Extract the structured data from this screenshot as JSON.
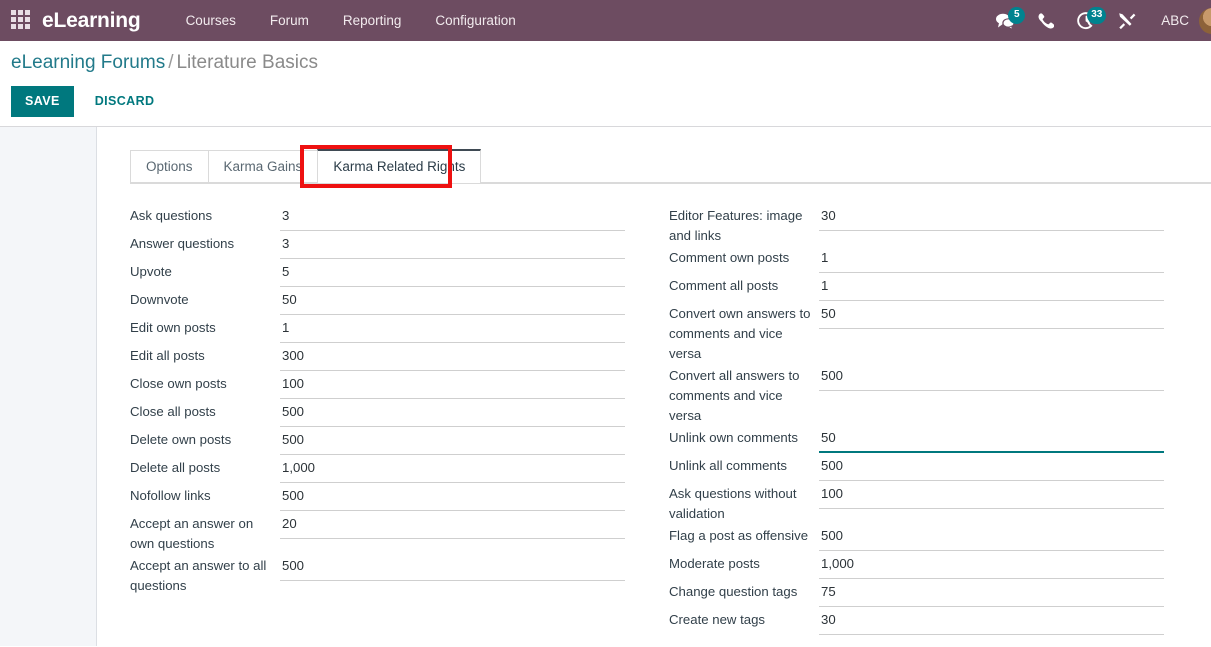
{
  "navbar": {
    "apps_icon": "apps-grid-icon",
    "brand": "eLearning",
    "menu": [
      {
        "label": "Courses"
      },
      {
        "label": "Forum"
      },
      {
        "label": "Reporting"
      },
      {
        "label": "Configuration"
      }
    ],
    "right": {
      "messages_icon": "chat-bubble-icon",
      "messages_count": "5",
      "phone_icon": "phone-icon",
      "activities_icon": "clock-moon-icon",
      "activities_count": "33",
      "tools_icon": "wrench-tools-icon",
      "user_name": "ABC",
      "avatar": "user-avatar"
    },
    "bg_color": "#6d4c61"
  },
  "control_panel": {
    "breadcrumb": {
      "root": "eLearning Forums",
      "separator": "/",
      "current": "Literature Basics"
    },
    "save_label": "SAVE",
    "discard_label": "DISCARD",
    "save_color": "#00787e"
  },
  "tabs": {
    "items": [
      {
        "label": "Options",
        "active": false
      },
      {
        "label": "Karma Gains",
        "active": false
      },
      {
        "label": "Karma Related Rights",
        "active": true
      }
    ],
    "highlight_color": "#ee1111"
  },
  "form": {
    "left_column": [
      {
        "label": "Ask questions",
        "value": "3"
      },
      {
        "label": "Answer questions",
        "value": "3"
      },
      {
        "label": "Upvote",
        "value": "5"
      },
      {
        "label": "Downvote",
        "value": "50"
      },
      {
        "label": "Edit own posts",
        "value": "1"
      },
      {
        "label": "Edit all posts",
        "value": "300"
      },
      {
        "label": "Close own posts",
        "value": "100"
      },
      {
        "label": "Close all posts",
        "value": "500"
      },
      {
        "label": "Delete own posts",
        "value": "500"
      },
      {
        "label": "Delete all posts",
        "value": "1,000"
      },
      {
        "label": "Nofollow links",
        "value": "500"
      },
      {
        "label": "Accept an answer on own questions",
        "value": "20"
      },
      {
        "label": "Accept an answer to all questions",
        "value": "500"
      }
    ],
    "right_column": [
      {
        "label": "Editor Features: image and links",
        "value": "30"
      },
      {
        "label": "Comment own posts",
        "value": "1"
      },
      {
        "label": "Comment all posts",
        "value": "1"
      },
      {
        "label": "Convert own answers to comments and vice versa",
        "value": "50"
      },
      {
        "label": "Convert all answers to comments and vice versa",
        "value": "500"
      },
      {
        "label": "Unlink own comments",
        "value": "50",
        "focused": true
      },
      {
        "label": "Unlink all comments",
        "value": "500"
      },
      {
        "label": "Ask questions without validation",
        "value": "100"
      },
      {
        "label": "Flag a post as offensive",
        "value": "500"
      },
      {
        "label": "Moderate posts",
        "value": "1,000"
      },
      {
        "label": "Change question tags",
        "value": "75"
      },
      {
        "label": "Create new tags",
        "value": "30"
      }
    ]
  }
}
